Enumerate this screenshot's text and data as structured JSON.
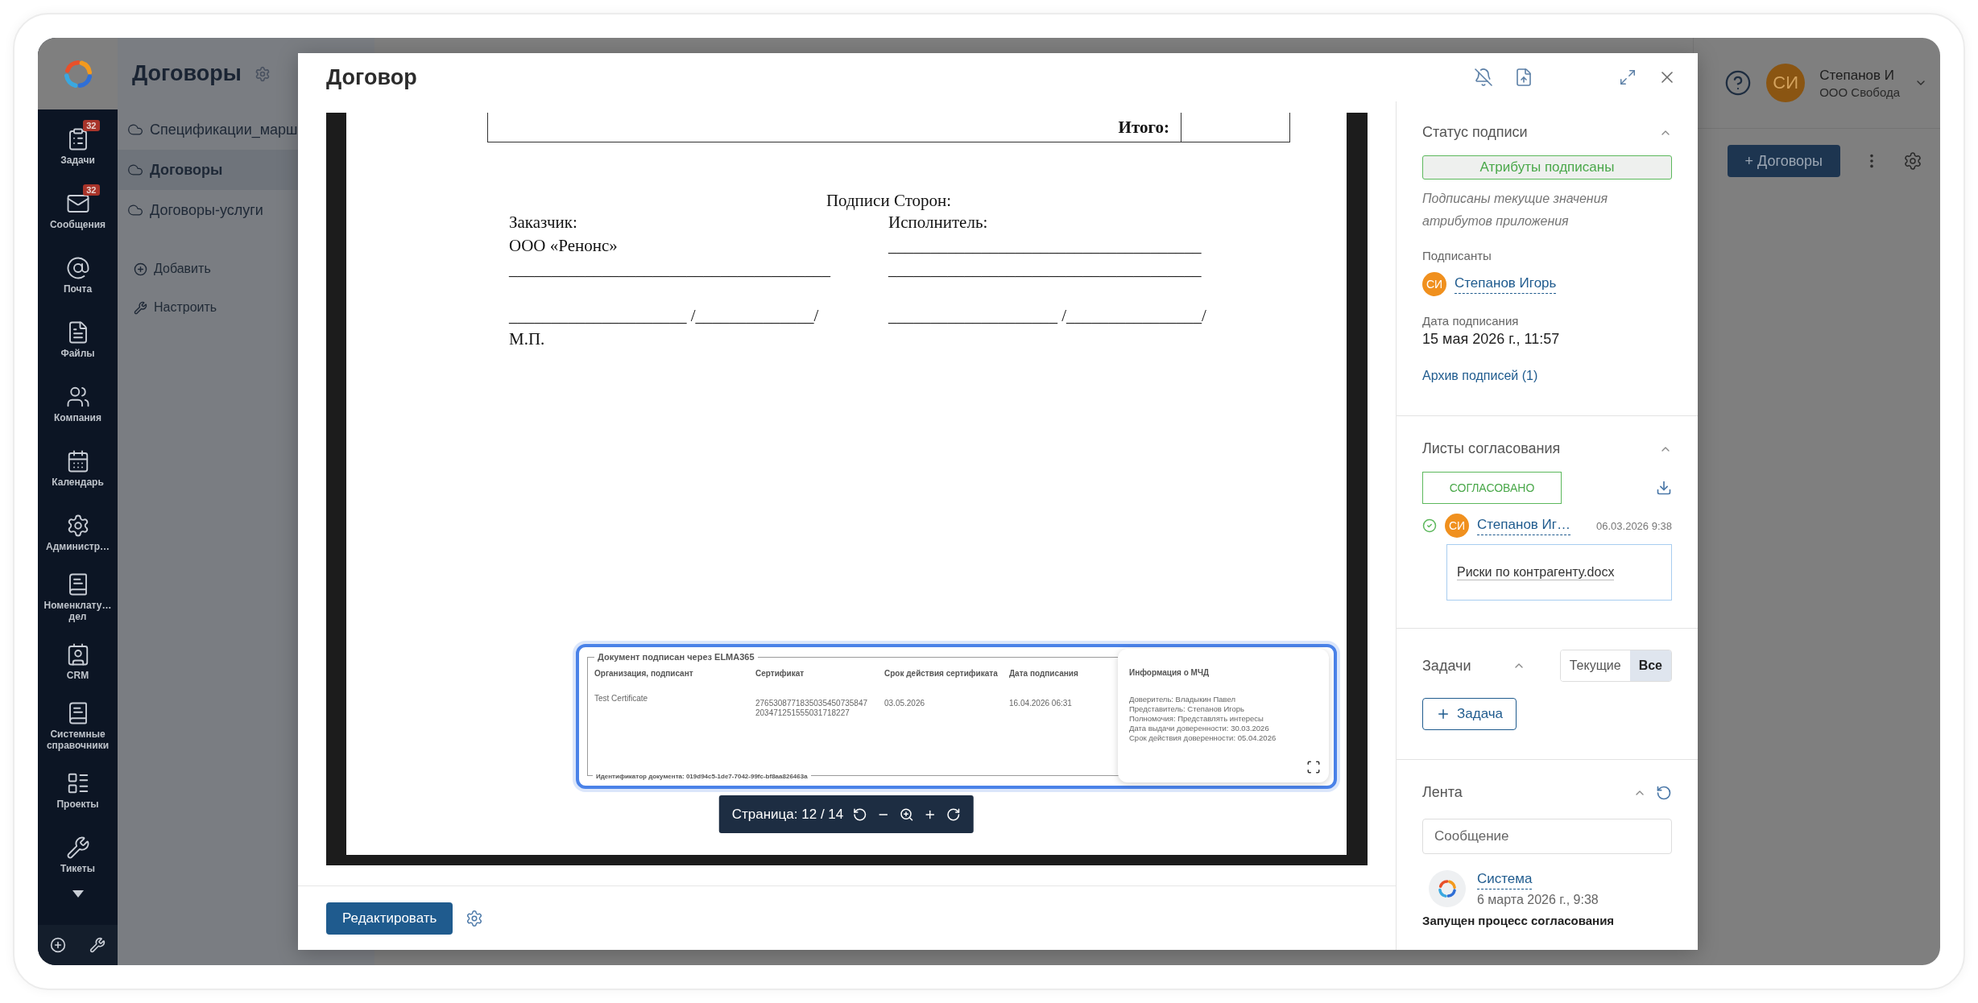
{
  "nav": {
    "items": [
      {
        "label": "Задачи",
        "badge": "32"
      },
      {
        "label": "Сообщения",
        "badge": "32"
      },
      {
        "label": "Почта"
      },
      {
        "label": "Файлы"
      },
      {
        "label": "Компания"
      },
      {
        "label": "Календарь"
      },
      {
        "label": "Администр…"
      },
      {
        "label": "Номенклату… дел"
      },
      {
        "label": "CRM"
      },
      {
        "label": "Системные справочники"
      },
      {
        "label": "Проекты"
      },
      {
        "label": "Тикеты"
      }
    ]
  },
  "section_panel": {
    "title": "Договоры",
    "items": [
      {
        "label": "Спецификации_марш",
        "selected": false
      },
      {
        "label": "Договоры",
        "selected": true
      },
      {
        "label": "Договоры-услуги",
        "selected": false
      }
    ],
    "actions": [
      "Добавить",
      "Настроить"
    ]
  },
  "header": {
    "user": {
      "initials": "СИ",
      "name": "Степанов И",
      "organization": "ООО Свобода"
    },
    "create_button": "+ Договоры"
  },
  "modal": {
    "title": "Договор",
    "document": {
      "total_label": "Итого:",
      "signatures_title": "Подписи Сторон:",
      "customer": {
        "label": "Заказчик:",
        "name": "ООО «Ренонс»",
        "signature_line": "______________________________________",
        "sign_row": "_____________________ /______________/",
        "stamp_label": "М.П."
      },
      "contractor": {
        "label": "Исполнитель:",
        "lines": [
          "_____________________________________",
          "_____________________________________"
        ],
        "sign_row": "____________________ /________________/"
      },
      "stamp": {
        "legend": "Документ подписан через ELMA365",
        "columns": [
          "Организация, подписант",
          "Сертификат",
          "Срок действия сертификата",
          "Дата подписания"
        ],
        "signer": "Test Certificate",
        "certificate": [
          "2765308771835035450735847",
          "203471251555031718227"
        ],
        "valid_until": "03.05.2026",
        "signed_at": "16.04.2026 06:31",
        "document_id": "Идентификатор документа: 019d94c5-1de7-7042-99fc-bf8aa826463a",
        "mchd": {
          "title": "Информация о МЧД",
          "lines": [
            "Доверитель: Владыкин Павел",
            "Представитель: Степанов Игорь",
            "Полномочия: Представлять интересы",
            "Дата выдачи доверенности: 30.03.2026",
            "Срок действия доверенности: 05.04.2026"
          ]
        }
      }
    },
    "page_toolbar": {
      "label": "Страница: 12 / 14"
    },
    "edit_button": "Редактировать"
  },
  "side_panel": {
    "signature_status": {
      "title": "Статус подписи",
      "expanded": true,
      "badge": "Атрибуты подписаны",
      "note": "Подписаны текущие значения атрибутов приложения",
      "signers_label": "Подписанты",
      "signers": [
        {
          "initials": "СИ",
          "name": "Степанов Игорь"
        }
      ],
      "date_label": "Дата подписания",
      "date": "15 мая 2026 г., 11:57",
      "archive_link": "Архив подписей (1)"
    },
    "approval_sheets": {
      "title": "Листы согласования",
      "expanded": true,
      "status": "СОГЛАСОВАНО",
      "approvers": [
        {
          "initials": "СИ",
          "name": "Степанов Иг…",
          "approved": true,
          "date": "06.03.2026 9:38",
          "file": "Риски по контрагенту.docx"
        }
      ]
    },
    "tasks": {
      "title": "Задачи",
      "expanded": true,
      "filters": [
        {
          "label": "Текущие",
          "selected": false
        },
        {
          "label": "Все",
          "selected": true
        }
      ],
      "add_button": "Задача"
    },
    "feed": {
      "title": "Лента",
      "expanded": true,
      "input": {
        "placeholder": "Сообщение"
      },
      "entries": [
        {
          "author": "Система",
          "date": "6 марта 2026 г., 9:38",
          "text": "Запущен процесс согласования"
        }
      ]
    }
  }
}
